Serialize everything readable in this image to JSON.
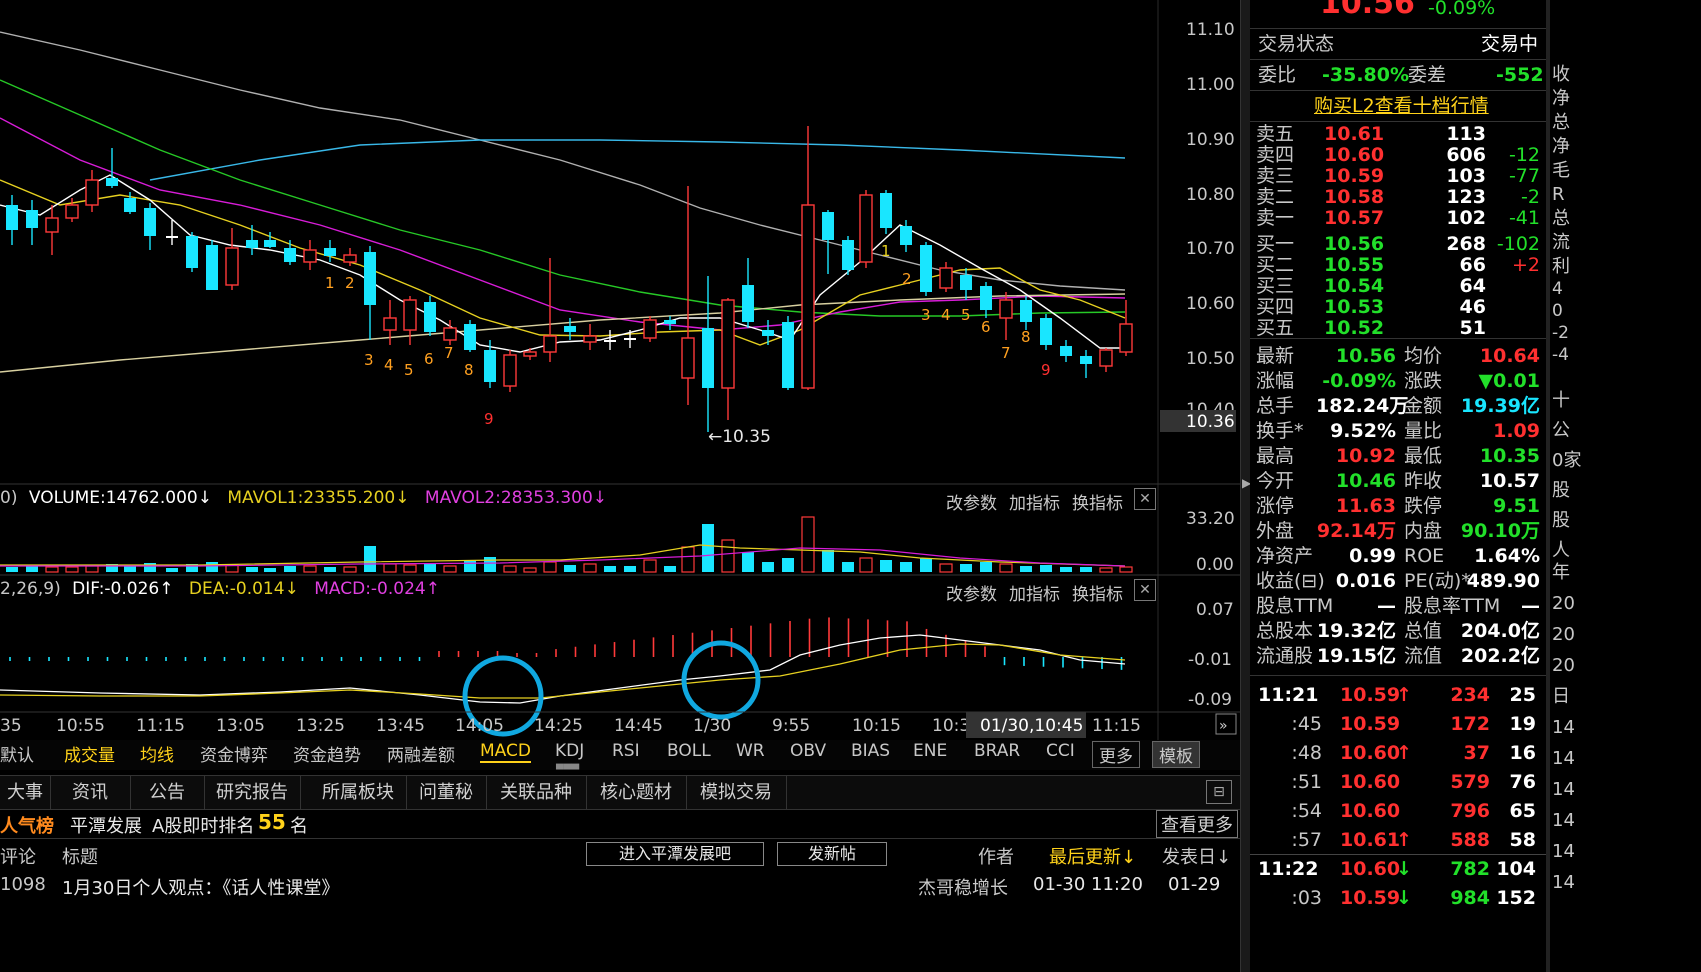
{
  "chart": {
    "price_ticks": [
      "11.10",
      "11.00",
      "10.90",
      "10.80",
      "10.70",
      "10.60",
      "10.50",
      "10.40"
    ],
    "price_current": "10.36",
    "low_marker": "←10.35",
    "seq_left": [
      "1",
      "2",
      "3",
      "4",
      "5",
      "6",
      "7",
      "8",
      "9"
    ],
    "seq_right": [
      "1",
      "2",
      "3",
      "4",
      "5",
      "6",
      "7",
      "8",
      "9"
    ],
    "seq_right_first": "1",
    "time_ticks": [
      "35",
      "10:55",
      "11:15",
      "13:05",
      "13:25",
      "13:45",
      "14:05",
      "14:25",
      "14:45",
      "1/30",
      "9:55",
      "10:15",
      "10:3",
      "11:15"
    ],
    "cursor_time": "01/30,10:45"
  },
  "volume": {
    "prefix": "0)",
    "label": "VOLUME:14762.000",
    "mavol1": "MAVOL1:23355.200",
    "mavol2": "MAVOL2:28353.300",
    "tick_high": "33.20",
    "tick_low": "0.00"
  },
  "macd": {
    "prefix": "2,26,9)",
    "dif": "DIF:-0.026",
    "dea": "DEA:-0.014",
    "macd": "MACD:-0.024",
    "tick_high": "0.07",
    "tick_mid": "-0.01",
    "tick_low": "-0.09"
  },
  "panel_buttons": {
    "params": "改参数",
    "add": "加指标",
    "swap": "换指标",
    "close": "✕"
  },
  "indicators": [
    "默认",
    "成交量",
    "均线",
    "资金博弈",
    "资金趋势",
    "两融差额",
    "MACD",
    "KDJ",
    "RSI",
    "BOLL",
    "WR",
    "OBV",
    "BIAS",
    "ENE",
    "BRAR",
    "CCI",
    "更多",
    "模板"
  ],
  "info_tabs": [
    "大事",
    "资讯",
    "公告",
    "研究报告",
    "所属板块",
    "问董秘",
    "关联品种",
    "核心题材",
    "模拟交易"
  ],
  "popularity": {
    "title": "人气榜",
    "item": "平潭发展",
    "rank_label": "A股即时排名",
    "rank": "55",
    "unit": "名",
    "more": "查看更多"
  },
  "forum": {
    "comment": "评论",
    "title": "标题",
    "enter": "进入平潭发展吧",
    "post": "发新帖",
    "author": "作者",
    "last_update": "最后更新↓",
    "post_date": "发表日↓"
  },
  "post_row": {
    "num": "1098",
    "title": "1月30日个人观点：《话人性课堂》",
    "author": "杰哥稳增长",
    "updated": "01-30 11:20",
    "date": "01-29"
  },
  "quote": {
    "price": "10.56",
    "change_pct": "-0.09%",
    "status_label": "交易状态",
    "status": "交易中",
    "wb_label": "委比",
    "wb": "-35.80%",
    "wc_label": "委差",
    "wc": "-552",
    "l2": "购买L2查看十档行情",
    "asks": [
      {
        "label": "卖五",
        "price": "10.61",
        "vol": "113",
        "chg": ""
      },
      {
        "label": "卖四",
        "price": "10.60",
        "vol": "606",
        "chg": "-12"
      },
      {
        "label": "卖三",
        "price": "10.59",
        "vol": "103",
        "chg": "-77"
      },
      {
        "label": "卖二",
        "price": "10.58",
        "vol": "123",
        "chg": "-2"
      },
      {
        "label": "卖一",
        "price": "10.57",
        "vol": "102",
        "chg": "-41"
      }
    ],
    "bids": [
      {
        "label": "买一",
        "price": "10.56",
        "vol": "268",
        "chg": "-102"
      },
      {
        "label": "买二",
        "price": "10.55",
        "vol": "66",
        "chg": "+2"
      },
      {
        "label": "买三",
        "price": "10.54",
        "vol": "64",
        "chg": ""
      },
      {
        "label": "买四",
        "price": "10.53",
        "vol": "46",
        "chg": ""
      },
      {
        "label": "买五",
        "price": "10.52",
        "vol": "51",
        "chg": ""
      }
    ],
    "stats": [
      {
        "l1": "最新",
        "v1": "10.56",
        "c1": "grn",
        "l2": "均价",
        "v2": "10.64",
        "c2": "red"
      },
      {
        "l1": "涨幅",
        "v1": "-0.09%",
        "c1": "grn",
        "l2": "涨跌",
        "v2": "▼0.01",
        "c2": "grn"
      },
      {
        "l1": "总手",
        "v1": "182.24万",
        "c1": "wht",
        "l2": "金额",
        "v2": "19.39亿",
        "c2": "cyn"
      },
      {
        "l1": "换手*",
        "v1": "9.52%",
        "c1": "wht",
        "l2": "量比",
        "v2": "1.09",
        "c2": "red"
      },
      {
        "l1": "最高",
        "v1": "10.92",
        "c1": "red",
        "l2": "最低",
        "v2": "10.35",
        "c2": "grn"
      },
      {
        "l1": "今开",
        "v1": "10.46",
        "c1": "grn",
        "l2": "昨收",
        "v2": "10.57",
        "c2": "wht"
      },
      {
        "l1": "涨停",
        "v1": "11.63",
        "c1": "red",
        "l2": "跌停",
        "v2": "9.51",
        "c2": "grn"
      },
      {
        "l1": "外盘",
        "v1": "92.14万",
        "c1": "red",
        "l2": "内盘",
        "v2": "90.10万",
        "c2": "grn"
      },
      {
        "l1": "净资产",
        "v1": "0.99",
        "c1": "wht",
        "l2": "ROE",
        "v2": "1.64%",
        "c2": "wht"
      },
      {
        "l1": "收益(⊟)",
        "v1": "0.016",
        "c1": "wht",
        "l2": "PE(动)*",
        "v2": "489.90",
        "c2": "wht"
      },
      {
        "l1": "股息TTM",
        "v1": "—",
        "c1": "wht",
        "l2": "股息率TTM",
        "v2": "—",
        "c2": "wht"
      },
      {
        "l1": "总股本",
        "v1": "19.32亿",
        "c1": "wht",
        "l2": "总值",
        "v2": "204.0亿",
        "c2": "wht"
      },
      {
        "l1": "流通股",
        "v1": "19.15亿",
        "c1": "wht",
        "l2": "流值",
        "v2": "202.2亿",
        "c2": "wht"
      }
    ],
    "ticks": [
      {
        "t": "11:21",
        "p": "10.59",
        "ar": "↑",
        "pc": "red",
        "v": "234",
        "vc": "red",
        "n": "25"
      },
      {
        "t": ":45",
        "p": "10.59",
        "ar": "",
        "pc": "red",
        "v": "172",
        "vc": "red",
        "n": "19"
      },
      {
        "t": ":48",
        "p": "10.60",
        "ar": "↑",
        "pc": "red",
        "v": "37",
        "vc": "red",
        "n": "16"
      },
      {
        "t": ":51",
        "p": "10.60",
        "ar": "",
        "pc": "red",
        "v": "579",
        "vc": "red",
        "n": "76"
      },
      {
        "t": ":54",
        "p": "10.60",
        "ar": "",
        "pc": "red",
        "v": "796",
        "vc": "red",
        "n": "65"
      },
      {
        "t": ":57",
        "p": "10.61",
        "ar": "↑",
        "pc": "red",
        "v": "588",
        "vc": "red",
        "n": "58"
      },
      {
        "t": "11:22",
        "p": "10.60",
        "ar": "↓",
        "pc": "red",
        "v": "782",
        "vc": "grn",
        "n": "104"
      },
      {
        "t": ":03",
        "p": "10.59",
        "ar": "↓",
        "pc": "red",
        "v": "984",
        "vc": "grn",
        "n": "152"
      }
    ],
    "side_labels": [
      "收",
      "净",
      "总",
      "净",
      "毛",
      "R",
      "总",
      "流",
      "利"
    ],
    "side_labels2": [
      "十",
      "公",
      "0家",
      "股",
      "股",
      "人"
    ],
    "side_labels3": [
      "年",
      "20",
      "20",
      "20",
      "日",
      "14",
      "14",
      "14",
      "14",
      "14",
      "14"
    ],
    "side_nums": [
      "4",
      "0",
      "-2",
      "-4"
    ]
  }
}
